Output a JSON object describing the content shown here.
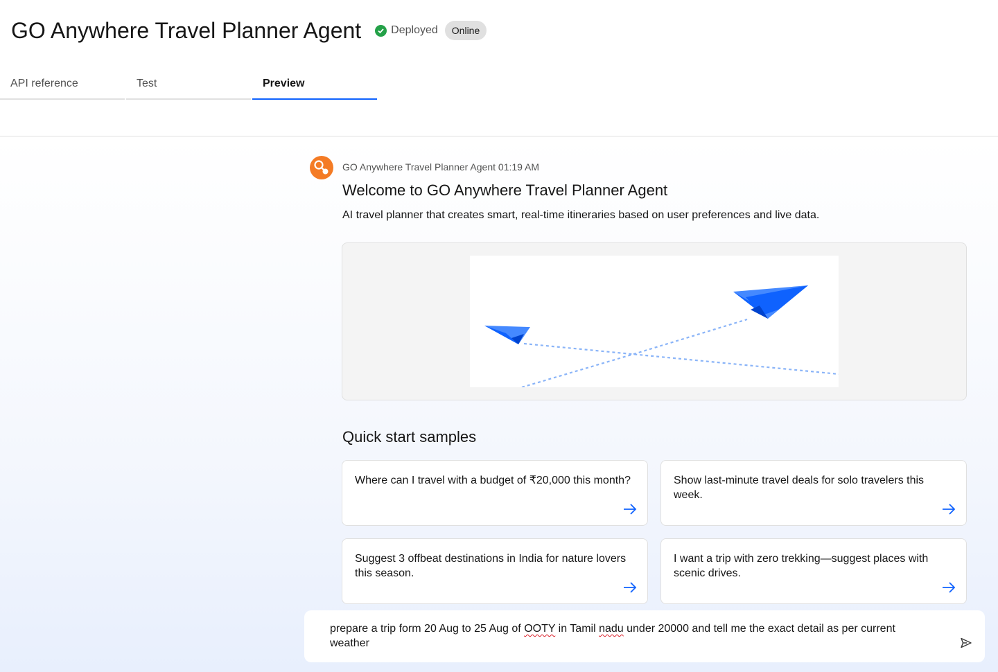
{
  "header": {
    "title": "GO Anywhere Travel Planner Agent",
    "status_label": "Deployed",
    "online_tag": "Online"
  },
  "tabs": [
    {
      "label": "API reference",
      "active": false
    },
    {
      "label": "Test",
      "active": false
    },
    {
      "label": "Preview",
      "active": true
    }
  ],
  "message": {
    "sender": "GO Anywhere Travel Planner Agent",
    "time": "01:19 AM",
    "welcome": "Welcome to GO Anywhere Travel Planner Agent",
    "description": "AI travel planner that creates smart, real-time itineraries based on user preferences and live data."
  },
  "quick_start": {
    "title": "Quick start samples",
    "samples": [
      "Where can I travel with a budget of ₹20,000 this month?",
      "Show last-minute travel deals for solo travelers this week.",
      "Suggest 3 offbeat destinations in India for nature lovers this season.",
      "I want a trip with zero trekking—suggest places with scenic drives."
    ]
  },
  "input": {
    "part1": "prepare a trip form 20 Aug to 25 Aug of ",
    "misspelled1": "OOTY",
    "part2": " in Tamil ",
    "misspelled2": "nadu",
    "part3": " under 20000 and tell me the exact detail as per current weather"
  },
  "colors": {
    "accent": "#0f62fe",
    "success": "#24a148",
    "avatar": "#f47b25",
    "plane": "#0f62fe"
  },
  "icons": {
    "status": "checkmark-circle-icon",
    "avatar": "agent-avatar-icon",
    "arrow": "arrow-right-icon",
    "send": "send-icon"
  }
}
